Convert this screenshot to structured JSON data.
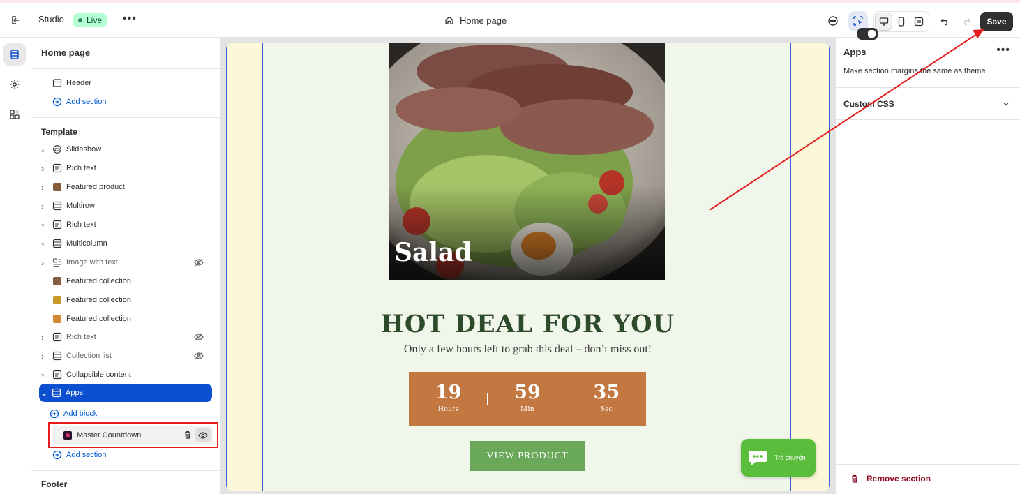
{
  "topbar": {
    "studio": "Studio",
    "live": "Live",
    "page": "Home page",
    "save": "Save"
  },
  "sidebar": {
    "title": "Home page",
    "header_items": [
      {
        "label": "Header"
      },
      {
        "label": "Add section"
      }
    ],
    "template_label": "Template",
    "template_items": [
      {
        "label": "Slideshow",
        "hidden": false
      },
      {
        "label": "Rich text",
        "hidden": false
      },
      {
        "label": "Featured product",
        "hidden": false
      },
      {
        "label": "Multirow",
        "hidden": false
      },
      {
        "label": "Rich text",
        "hidden": false
      },
      {
        "label": "Multicolumn",
        "hidden": false
      },
      {
        "label": "Image with text",
        "hidden": true
      },
      {
        "label": "Featured collection",
        "hidden": false
      },
      {
        "label": "Featured collection",
        "hidden": false
      },
      {
        "label": "Featured collection",
        "hidden": false
      },
      {
        "label": "Rich text",
        "hidden": true
      },
      {
        "label": "Collection list",
        "hidden": true
      },
      {
        "label": "Collapsible content",
        "hidden": false
      },
      {
        "label": "Apps",
        "hidden": false,
        "selected": true
      }
    ],
    "add_block": "Add block",
    "app_block": "Master Countdown",
    "add_section_2": "Add section",
    "footer_label": "Footer"
  },
  "preview": {
    "image_caption": "Salad",
    "title": "HOT DEAL FOR YOU",
    "subtitle": "Only a few hours left to grab this deal – don’t miss out!",
    "countdown": [
      {
        "value": "19",
        "unit": "Hours"
      },
      {
        "value": "59",
        "unit": "Min"
      },
      {
        "value": "35",
        "unit": "Sec"
      }
    ],
    "button": "VIEW PRODUCT",
    "chat": "Trò chuyện"
  },
  "panel": {
    "title": "Apps",
    "toggle_label": "Make section margins the same as theme",
    "toggle_on": true,
    "custom_css": "Custom CSS",
    "remove": "Remove section"
  },
  "colors": {
    "accent": "#0d4fd1",
    "live_bg": "#b4fed2",
    "countdown_bg": "#c47841",
    "button_bg": "#6aa85a",
    "annotation_red": "#e51c1c"
  }
}
